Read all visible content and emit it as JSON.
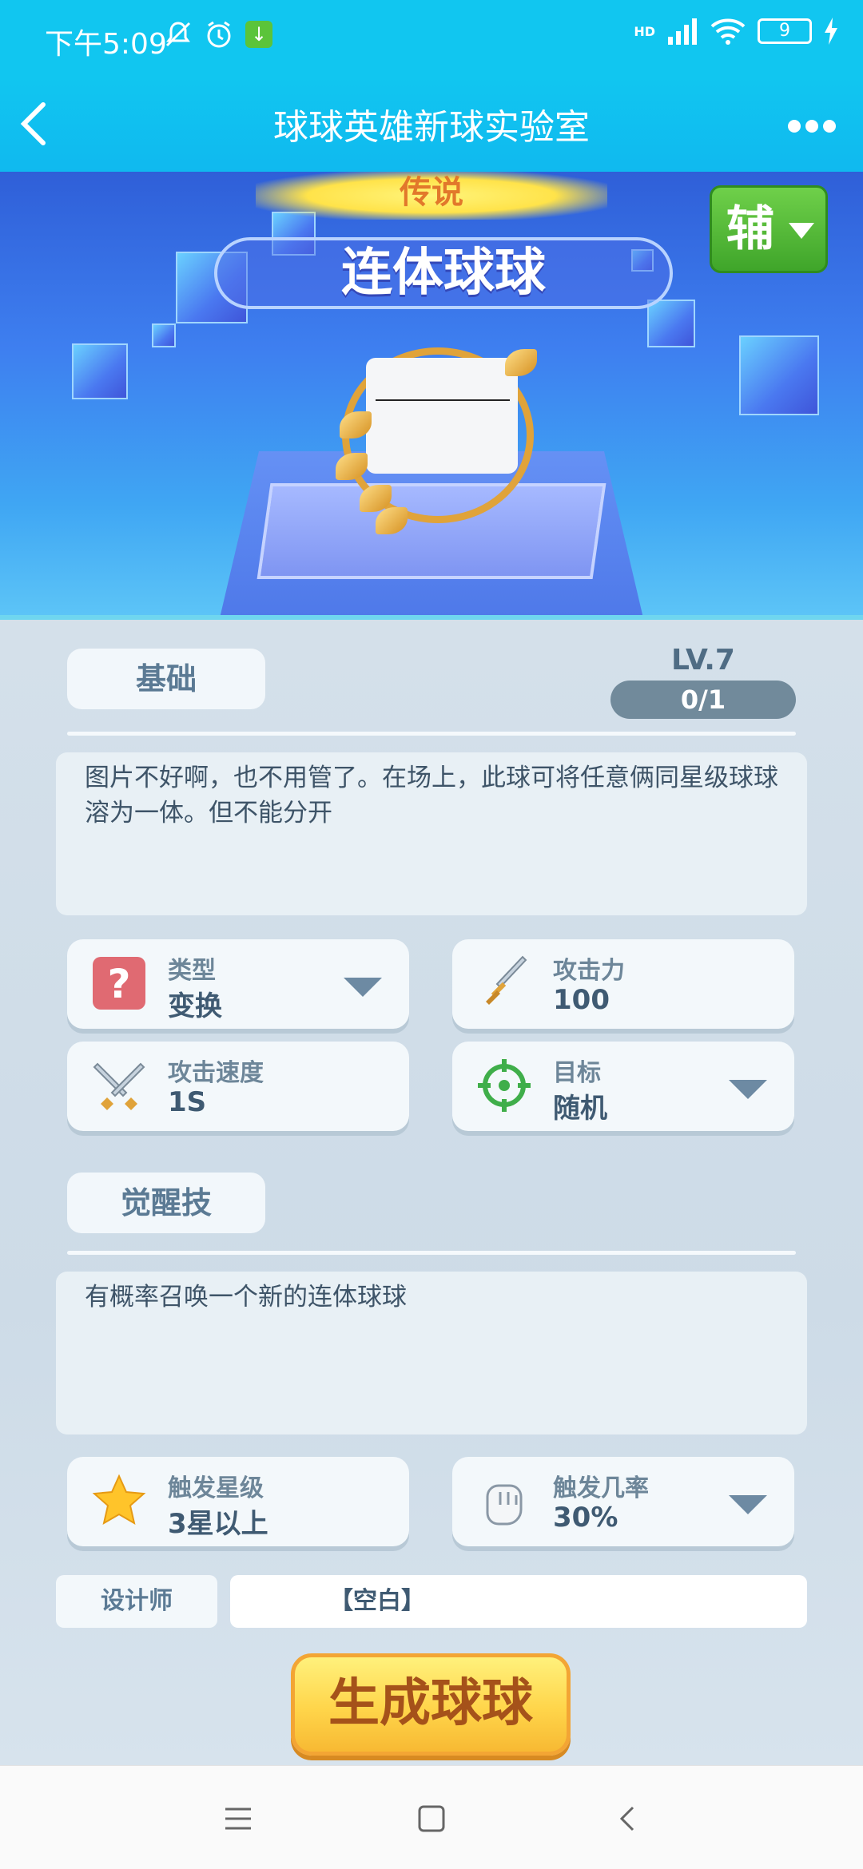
{
  "status_bar": {
    "time": "下午5:09",
    "battery": "9",
    "network": "HD"
  },
  "nav": {
    "title": "球球英雄新球实验室",
    "back_icon": "chevron-left-icon",
    "more_icon": "more-dots-icon"
  },
  "hero": {
    "rarity": "传说",
    "name": "连体球球",
    "role": "辅"
  },
  "basic": {
    "tab_label": "基础",
    "level": "LV.7",
    "progress_text": "0/1",
    "description": "图片不好啊，也不用管了。在场上，此球可将任意俩同星级球球溶为一体。但不能分开"
  },
  "stats": {
    "type": {
      "label": "类型",
      "value": "变换",
      "icon": "question-icon"
    },
    "attack": {
      "label": "攻击力",
      "value": "100",
      "icon": "sword-icon"
    },
    "speed": {
      "label": "攻击速度",
      "value": "1S",
      "icon": "crossed-swords-icon"
    },
    "target": {
      "label": "目标",
      "value": "随机",
      "icon": "target-icon"
    }
  },
  "awaken": {
    "tab_label": "觉醒技",
    "description": "有概率召唤一个新的连体球球",
    "trigger_star": {
      "label": "触发星级",
      "value": "3星以上",
      "icon": "star-icon"
    },
    "trigger_rate": {
      "label": "触发几率",
      "value": "30%",
      "icon": "hand-icon"
    }
  },
  "designer": {
    "label": "设计师",
    "value": "【空白】"
  },
  "generate_button": "生成球球",
  "colors": {
    "header": "#11c6f0",
    "panel": "#d4e0ea",
    "accent_yellow": "#ffd54a",
    "role_green": "#3fa52a"
  }
}
